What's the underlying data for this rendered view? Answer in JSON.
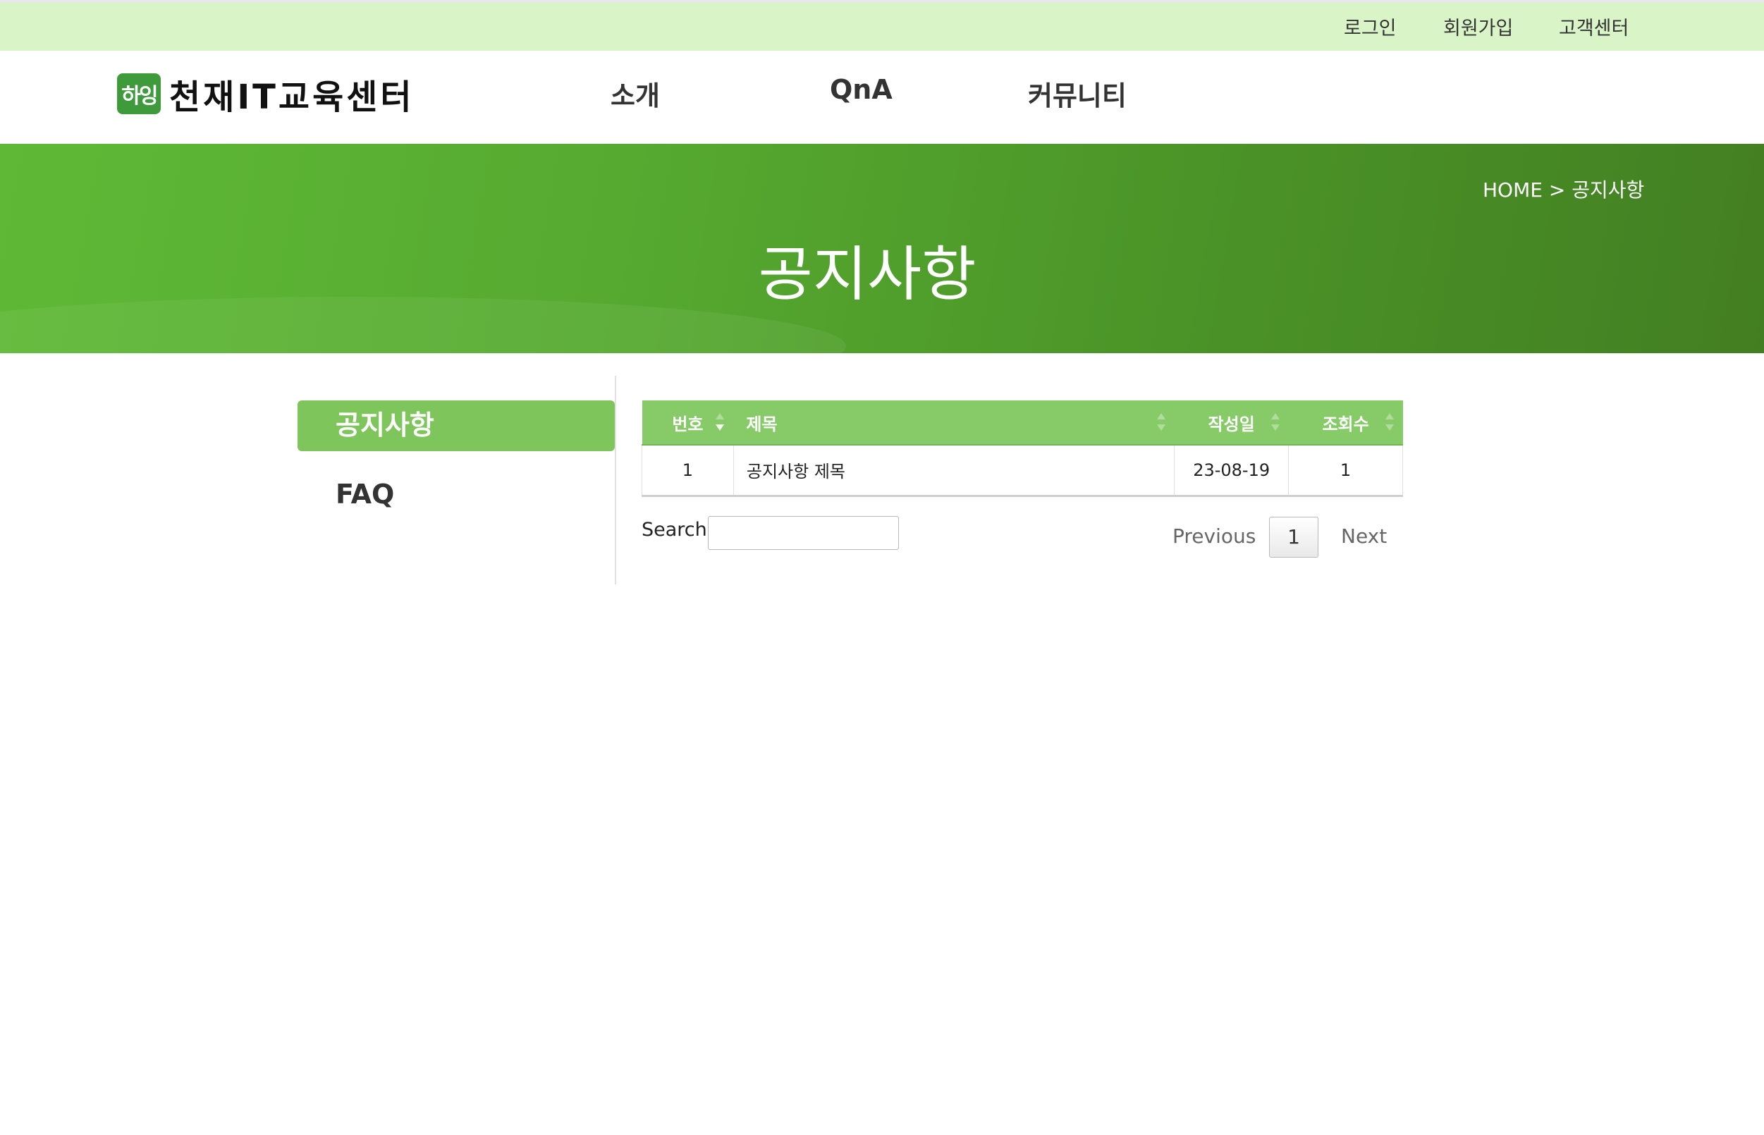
{
  "topbar": {
    "login": "로그인",
    "join": "회원가입",
    "customer_center": "고객센터"
  },
  "header": {
    "logo_mark": "하잉",
    "logo_text": "천재IT교육센터",
    "nav": [
      "소개",
      "QnA",
      "커뮤니티"
    ]
  },
  "hero": {
    "breadcrumb": "HOME > 공지사항",
    "title": "공지사항"
  },
  "side_menu": {
    "items": [
      "공지사항",
      "FAQ"
    ],
    "active": "공지사항"
  },
  "table": {
    "columns": [
      "번호",
      "제목",
      "작성일",
      "조회수"
    ],
    "rows": [
      {
        "no": "1",
        "title": "공지사항 제목",
        "date": "23-08-19",
        "views": "1"
      }
    ]
  },
  "search": {
    "label": "Search:",
    "value": ""
  },
  "pagination": {
    "previous": "Previous",
    "current": "1",
    "next": "Next"
  },
  "colors": {
    "topbar": "#d9f5c8",
    "banner": "#56aa30",
    "accent": "#86cb67",
    "active_menu": "#7ec65c"
  }
}
